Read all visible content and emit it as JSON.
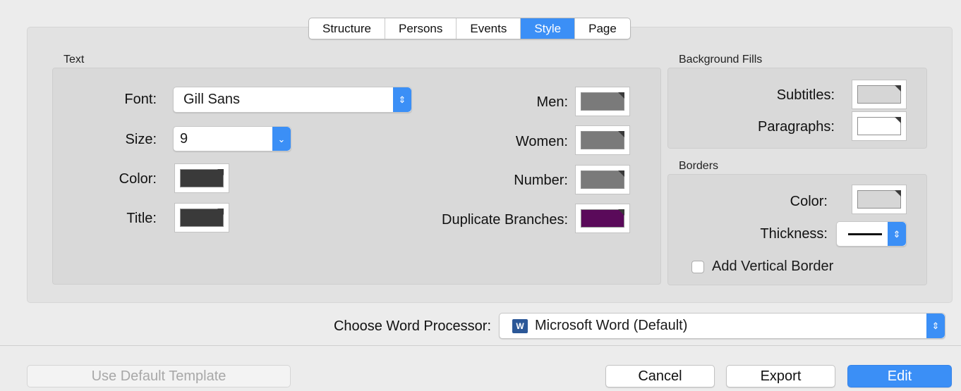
{
  "tabs": [
    {
      "label": "Structure",
      "active": false
    },
    {
      "label": "Persons",
      "active": false
    },
    {
      "label": "Events",
      "active": false
    },
    {
      "label": "Style",
      "active": true
    },
    {
      "label": "Page",
      "active": false
    }
  ],
  "text_group": {
    "title": "Text",
    "font_label": "Font:",
    "font_value": "Gill Sans",
    "size_label": "Size:",
    "size_value": "9",
    "color_label": "Color:",
    "title_label": "Title:",
    "men_label": "Men:",
    "women_label": "Women:",
    "number_label": "Number:",
    "duplicate_label": "Duplicate Branches:"
  },
  "background_fills": {
    "title": "Background Fills",
    "subtitles_label": "Subtitles:",
    "paragraphs_label": "Paragraphs:"
  },
  "borders": {
    "title": "Borders",
    "color_label": "Color:",
    "thickness_label": "Thickness:",
    "vertical_border_label": "Add Vertical Border",
    "vertical_border_checked": false
  },
  "word_processor": {
    "label": "Choose Word Processor:",
    "value": "Microsoft Word (Default)",
    "icon": "W"
  },
  "buttons": {
    "use_default": "Use Default Template",
    "cancel": "Cancel",
    "export": "Export",
    "edit": "Edit"
  },
  "colors": {
    "accent": "#3b8ff6",
    "text_color": "#3a3a3a",
    "title_color": "#3a3a3a",
    "men_color": "#7a7a7a",
    "women_color": "#7a7a7a",
    "number_color": "#7a7a7a",
    "duplicate_branches_color": "#5a0a5a",
    "subtitles_fill": "#d6d6d6",
    "paragraphs_fill": "#ffffff",
    "border_color": "#d6d6d6"
  }
}
